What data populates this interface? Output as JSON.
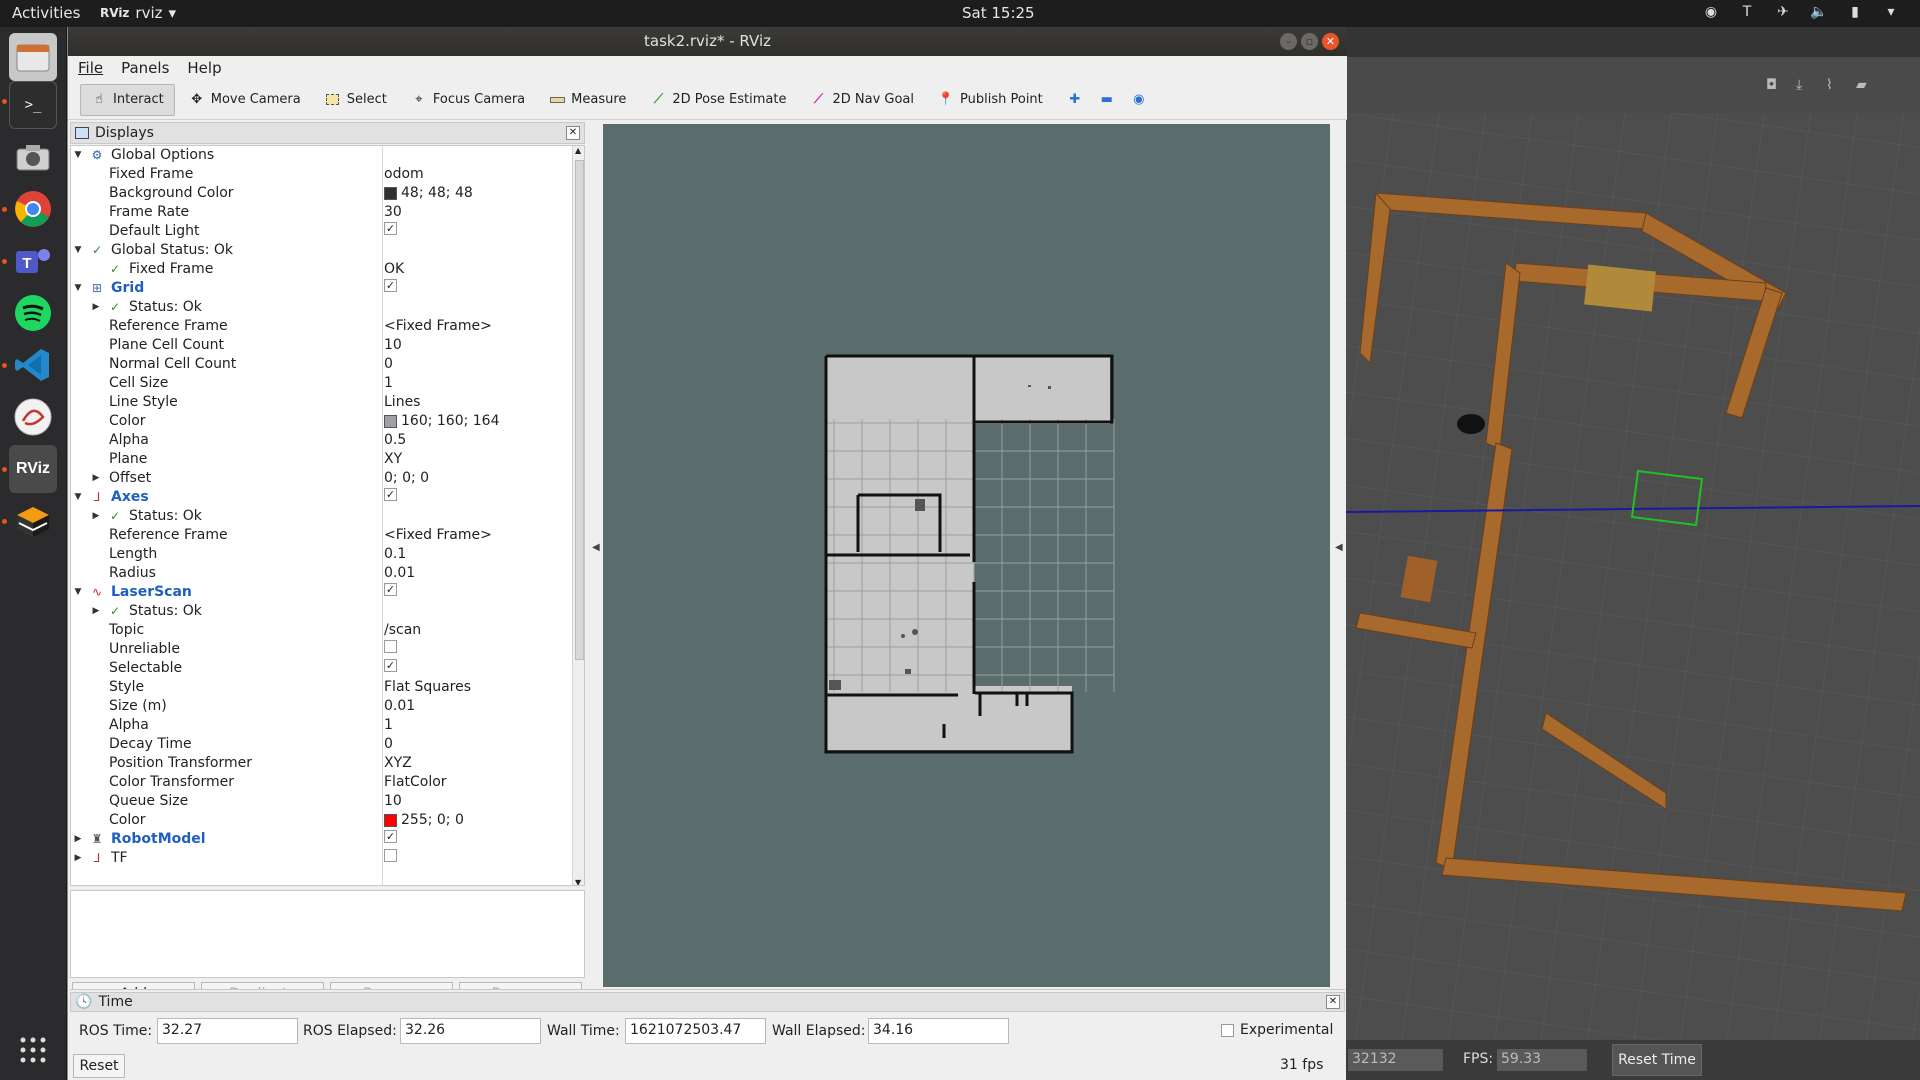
{
  "topbar": {
    "activities": "Activities",
    "app_name": "rviz",
    "app_badge": "RViz",
    "clock": "Sat 15:25"
  },
  "window": {
    "title": "task2.rviz* - RViz"
  },
  "menu": {
    "file": "File",
    "panels": "Panels",
    "help": "Help"
  },
  "toolbar": {
    "interact": "Interact",
    "move_camera": "Move Camera",
    "select": "Select",
    "focus_camera": "Focus Camera",
    "measure": "Measure",
    "pose_estimate": "2D Pose Estimate",
    "nav_goal": "2D Nav Goal",
    "publish_point": "Publish Point"
  },
  "displays": {
    "title": "Displays",
    "rows": {
      "global_options": "Global Options",
      "fixed_frame_label": "Fixed Frame",
      "fixed_frame_value": "odom",
      "bg_color_label": "Background Color",
      "bg_color_value": "48; 48; 48",
      "frame_rate_label": "Frame Rate",
      "frame_rate_value": "30",
      "default_light_label": "Default Light",
      "global_status": "Global Status: Ok",
      "gs_fixed_frame": "Fixed Frame",
      "gs_fixed_frame_value": "OK",
      "grid": "Grid",
      "grid_status": "Status: Ok",
      "grid_ref_label": "Reference Frame",
      "grid_ref_value": "<Fixed Frame>",
      "plane_cell_label": "Plane Cell Count",
      "plane_cell_value": "10",
      "normal_cell_label": "Normal Cell Count",
      "normal_cell_value": "0",
      "cell_size_label": "Cell Size",
      "cell_size_value": "1",
      "line_style_label": "Line Style",
      "line_style_value": "Lines",
      "grid_color_label": "Color",
      "grid_color_value": "160; 160; 164",
      "grid_alpha_label": "Alpha",
      "grid_alpha_value": "0.5",
      "plane_label": "Plane",
      "plane_value": "XY",
      "offset_label": "Offset",
      "offset_value": "0; 0; 0",
      "axes": "Axes",
      "axes_status": "Status: Ok",
      "axes_ref_label": "Reference Frame",
      "axes_ref_value": "<Fixed Frame>",
      "length_label": "Length",
      "length_value": "0.1",
      "radius_label": "Radius",
      "radius_value": "0.01",
      "laserscan": "LaserScan",
      "ls_status": "Status: Ok",
      "topic_label": "Topic",
      "topic_value": "/scan",
      "unreliable_label": "Unreliable",
      "selectable_label": "Selectable",
      "style_label": "Style",
      "style_value": "Flat Squares",
      "size_label": "Size (m)",
      "size_value": "0.01",
      "ls_alpha_label": "Alpha",
      "ls_alpha_value": "1",
      "decay_label": "Decay Time",
      "decay_value": "0",
      "pos_tf_label": "Position Transformer",
      "pos_tf_value": "XYZ",
      "color_tf_label": "Color Transformer",
      "color_tf_value": "FlatColor",
      "queue_label": "Queue Size",
      "queue_value": "10",
      "ls_color_label": "Color",
      "ls_color_value": "255; 0; 0",
      "robotmodel": "RobotModel",
      "tf": "TF"
    },
    "buttons": {
      "add": "Add",
      "duplicate": "Duplicate",
      "remove": "Remove",
      "rename": "Rename"
    }
  },
  "time_panel": {
    "title": "Time",
    "ros_time_label": "ROS Time:",
    "ros_time_value": "32.27",
    "ros_elapsed_label": "ROS Elapsed:",
    "ros_elapsed_value": "32.26",
    "wall_time_label": "Wall Time:",
    "wall_time_value": "1621072503.47",
    "wall_elapsed_label": "Wall Elapsed:",
    "wall_elapsed_value": "34.16",
    "experimental": "Experimental",
    "reset": "Reset",
    "fps": "31 fps"
  },
  "gazebo": {
    "sim_value": "32132",
    "fps_label": "FPS:",
    "fps_value": "59.33",
    "reset_time": "Reset Time"
  },
  "colors": {
    "accent": "#e95420",
    "bg_swatch": "#303030",
    "grid_swatch": "#a0a0a4",
    "laser_swatch": "#ff0000",
    "viewport_bg": "#5b6c6c",
    "display_name_blue": "#1f5fbf"
  }
}
